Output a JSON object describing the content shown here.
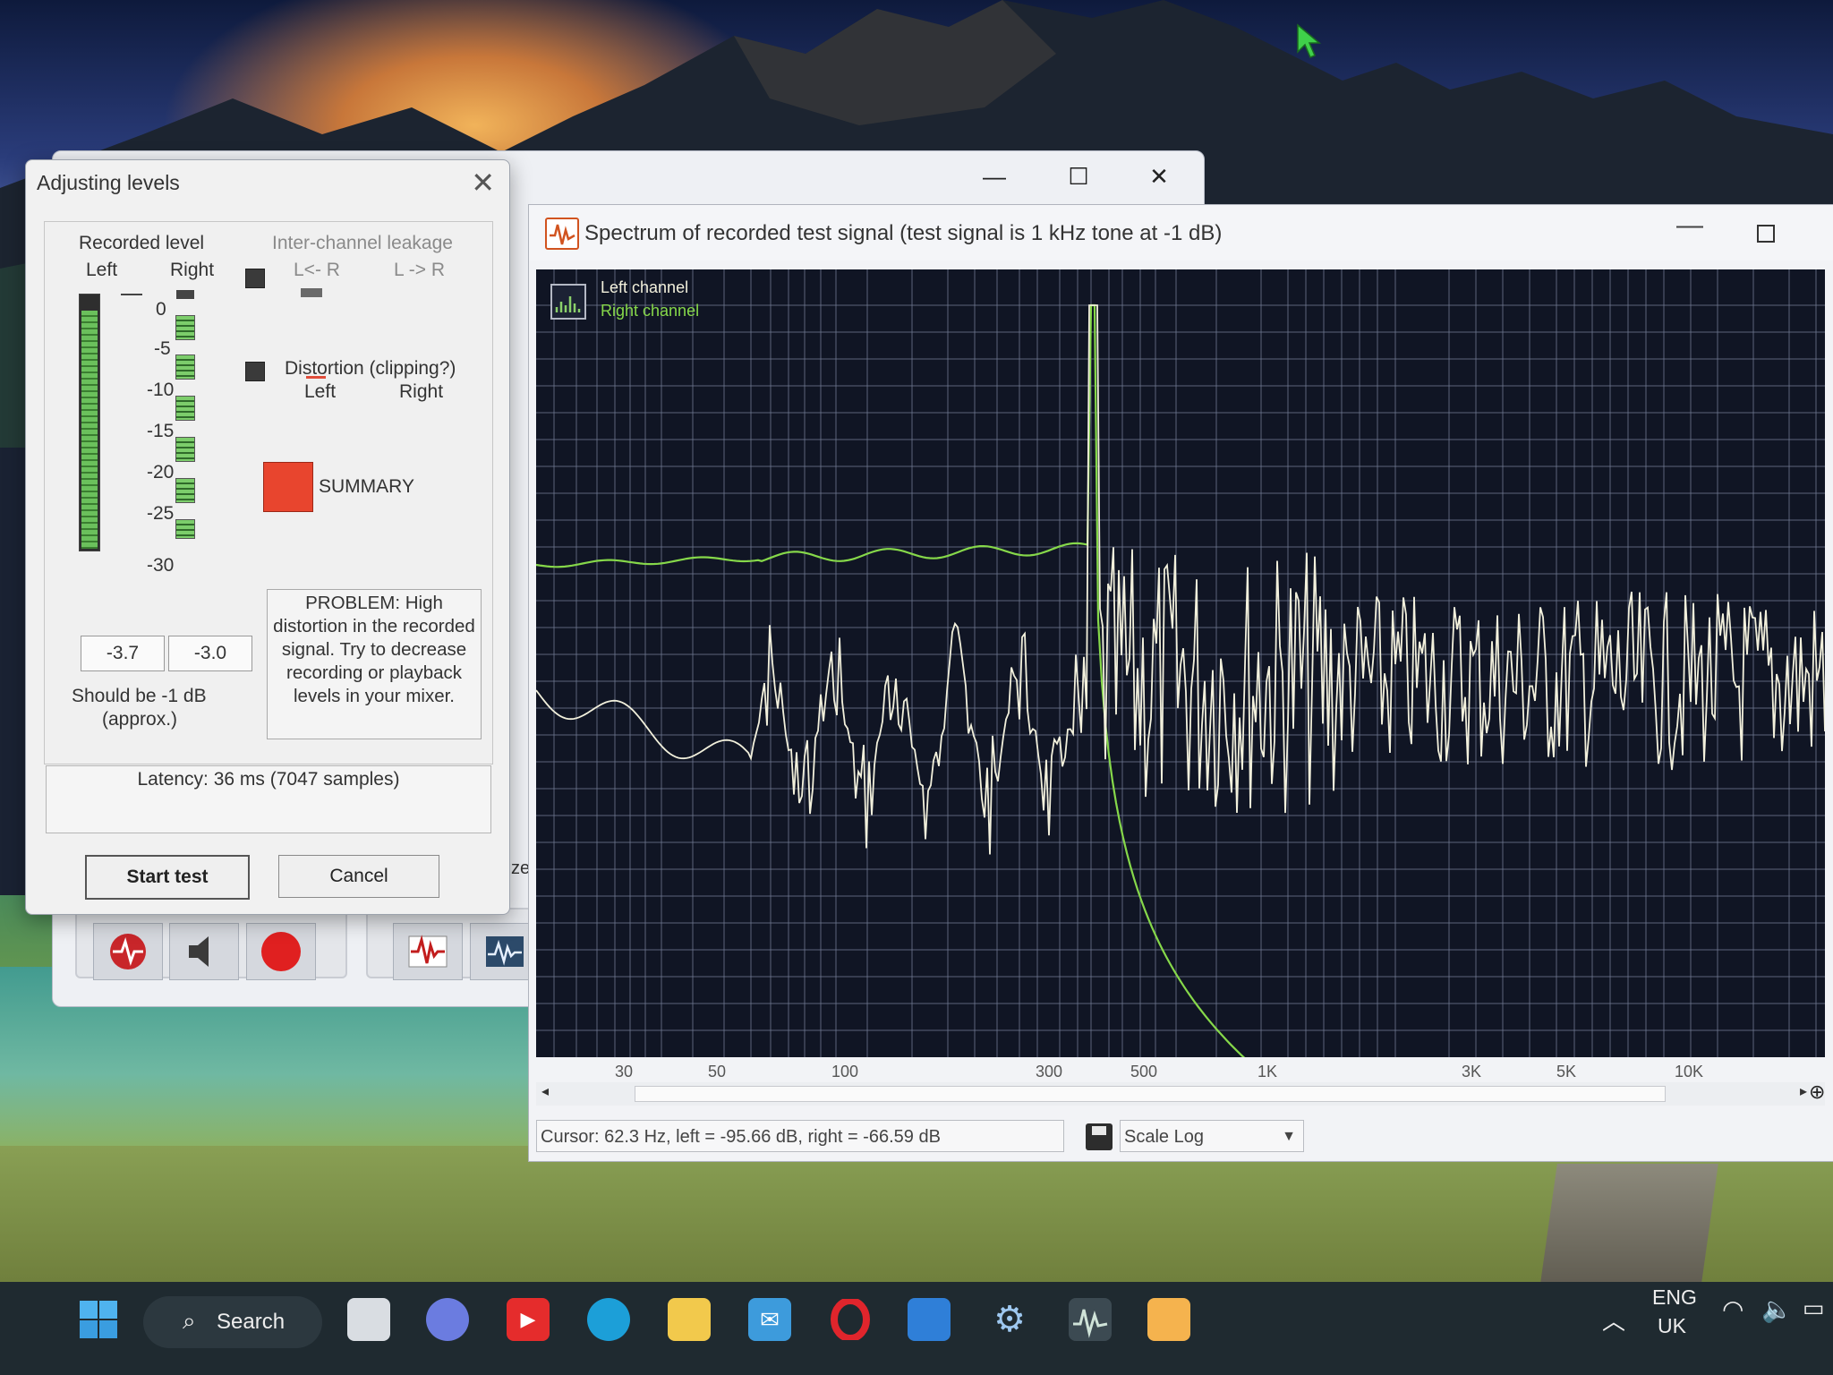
{
  "adjusting_levels": {
    "title": "Adjusting levels",
    "recorded_level_label": "Recorded level",
    "left_label": "Left",
    "right_label": "Right",
    "left_meter_fraction": 0.95,
    "right_meter_fraction": 0.95,
    "scale_ticks": [
      "0",
      "-5",
      "-10",
      "-15",
      "-20",
      "-25",
      "-30"
    ],
    "left_value": "-3.7",
    "right_value": "-3.0",
    "should_be_line1": "Should be  -1 dB",
    "should_be_line2": "(approx.)",
    "inter_channel_label": "Inter-channel leakage",
    "l_from_r": "L<- R",
    "l_to_r": "L -> R",
    "distortion_label": "Distortion (clipping?)",
    "distortion_left": "Left",
    "distortion_right": "Right",
    "summary_label": "SUMMARY",
    "summary_color": "#e8452e",
    "problem_text": "PROBLEM: High distortion in the recorded signal. Try to decrease recording or playback levels in your mixer.",
    "latency_text": "Latency: 36 ms (7047 samples)",
    "start_button": "Start test",
    "cancel_button": "Cancel"
  },
  "back_window": {
    "partial_label": "ze"
  },
  "spectrum": {
    "title": "Spectrum of recorded test signal (test signal is 1 kHz tone at -1 dB)",
    "legend_left": "Left channel",
    "legend_right": "Right channel",
    "left_color": "#f2f0dc",
    "right_color": "#86d84a",
    "x_ticks": [
      "30",
      "50",
      "100",
      "300",
      "500",
      "1K",
      "3K",
      "5K",
      "10K"
    ],
    "status": "Cursor:  62.3 Hz,  left = -95.66 dB,  right = -66.59 dB",
    "scale_label": "Scale",
    "scale_value": "Log"
  },
  "taskbar": {
    "search_label": "Search",
    "lang_top": "ENG",
    "lang_bottom": "UK"
  }
}
